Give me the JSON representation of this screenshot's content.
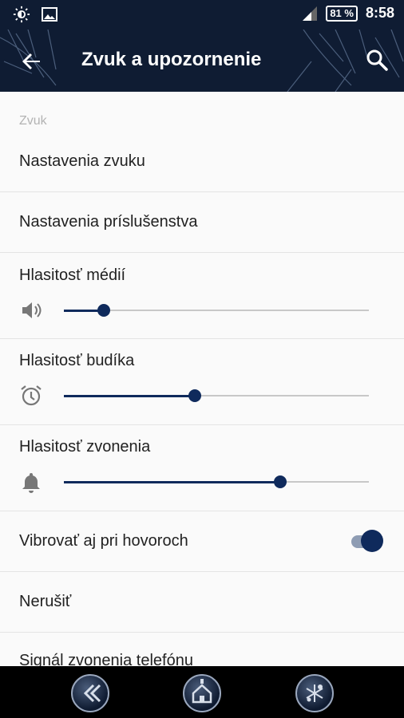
{
  "status_bar": {
    "battery": "81 %",
    "time": "8:58"
  },
  "toolbar": {
    "title": "Zvuk a upozornenie"
  },
  "section": {
    "header": "Zvuk"
  },
  "items": {
    "sound_settings": "Nastavenia zvuku",
    "accessory_settings": "Nastavenia príslušenstva",
    "media_volume": {
      "label": "Hlasitosť médií",
      "level": 0.13
    },
    "alarm_volume": {
      "label": "Hlasitosť budíka",
      "level": 0.43
    },
    "ring_volume": {
      "label": "Hlasitosť zvonenia",
      "level": 0.71
    },
    "vibrate_calls": {
      "label": "Vibrovať aj pri hovoroch",
      "enabled": true
    },
    "do_not_disturb": "Nerušiť",
    "ringtone": "Signál zvonenia telefónu"
  },
  "colors": {
    "header_bg": "#0f1c33",
    "accent": "#0f2a5c",
    "track": "#c8c8c8"
  }
}
